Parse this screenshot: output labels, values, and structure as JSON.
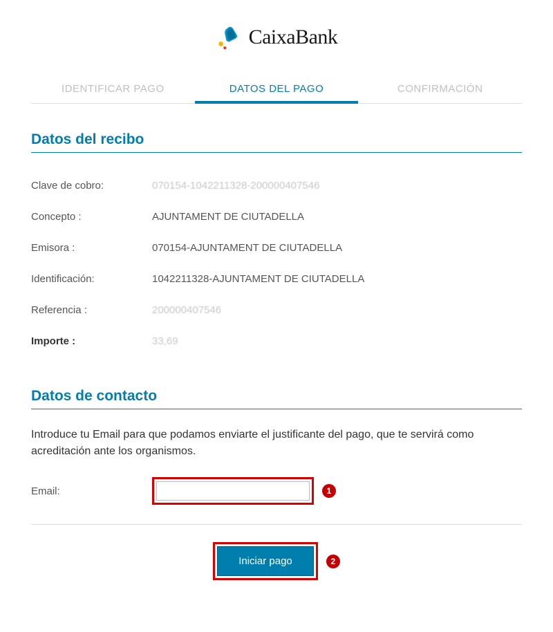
{
  "logo": {
    "text": "CaixaBank"
  },
  "tabs": {
    "identificar": "IDENTIFICAR PAGO",
    "datos": "DATOS DEL PAGO",
    "confirmacion": "CONFIRMACIÓN"
  },
  "section1": {
    "title": "Datos del recibo",
    "rows": {
      "clave": {
        "label": "Clave de cobro:",
        "value": "070154-1042211328-200000407546"
      },
      "concepto": {
        "label": "Concepto :",
        "value": "AJUNTAMENT DE CIUTADELLA"
      },
      "emisora": {
        "label": "Emisora :",
        "value": "070154-AJUNTAMENT DE CIUTADELLA"
      },
      "identificacion": {
        "label": "Identificación:",
        "value": "1042211328-AJUNTAMENT DE CIUTADELLA"
      },
      "referencia": {
        "label": "Referencia :",
        "value": "200000407546"
      },
      "importe": {
        "label": "Importe :",
        "value": "33,69"
      }
    }
  },
  "section2": {
    "title": "Datos de contacto",
    "intro": "Introduce tu Email para que podamos enviarte el justificante del pago, que te servirá como acreditación ante los organismos.",
    "emailLabel": "Email:",
    "emailValue": ""
  },
  "callouts": {
    "one": "1",
    "two": "2"
  },
  "button": {
    "submit": "Iniciar pago"
  }
}
